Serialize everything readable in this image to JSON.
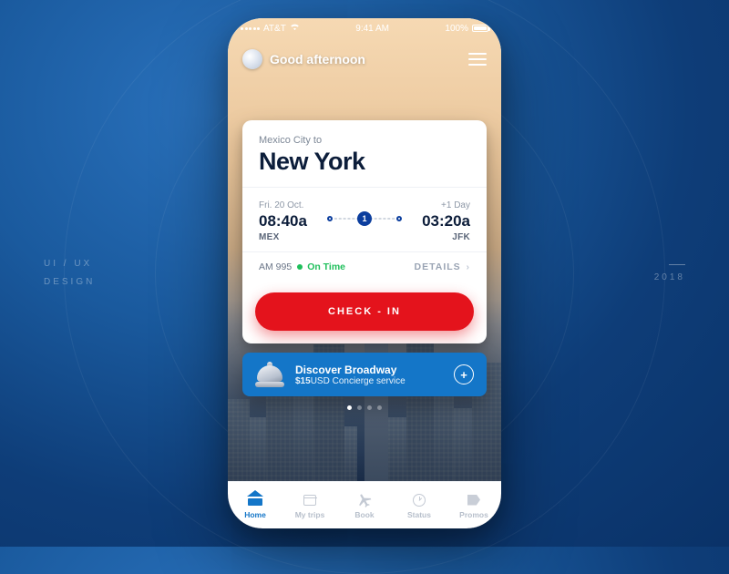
{
  "page": {
    "caption_left_1": "UI / UX",
    "caption_left_2": "DESIGN",
    "caption_right": "2018"
  },
  "status": {
    "carrier": "AT&T",
    "time": "9:41 AM",
    "battery": "100%"
  },
  "header": {
    "greeting": "Good afternoon"
  },
  "trip": {
    "origin_city": "Mexico City",
    "to_word": "to",
    "destination_city": "New York",
    "depart": {
      "date_label": "Fri. 20 Oct.",
      "time": "08:40a",
      "airport": "MEX"
    },
    "arrive": {
      "day_offset": "+1 Day",
      "time": "03:20a",
      "airport": "JFK"
    },
    "stops": "1",
    "flight_no": "AM 995",
    "status": "On Time",
    "status_color": "#1fbf5b",
    "details_label": "DETAILS",
    "checkin_label": "CHECK - IN"
  },
  "promo": {
    "title": "Discover Broadway",
    "price": "$15",
    "currency": "USD",
    "subtitle": "Concierge service"
  },
  "pager": {
    "count": 4,
    "active": 0
  },
  "tabs": [
    "Home",
    "My trips",
    "Book",
    "Status",
    "Promos"
  ],
  "colors": {
    "accent": "#1476c8",
    "danger": "#e4131c"
  }
}
